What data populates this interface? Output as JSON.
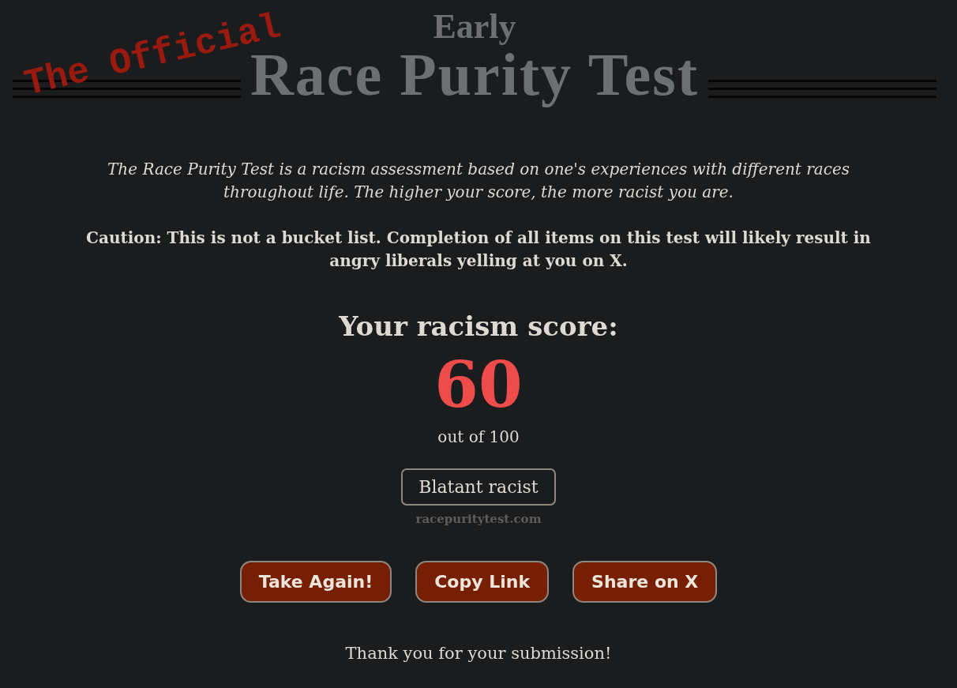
{
  "header": {
    "stamp": "The Official",
    "prefix": "Early",
    "title": "Race Purity Test"
  },
  "intro": "The Race Purity Test is a racism assessment based on one's experiences with different races throughout life. The higher your score, the more racist you are.",
  "caution": "Caution: This is not a bucket list. Completion of all items on this test will likely result in angry liberals yelling at you on X.",
  "score": {
    "heading": "Your racism score:",
    "value": "60",
    "out_of": "out of 100"
  },
  "verdict": "Blatant racist",
  "site": "racepuritytest.com",
  "buttons": [
    "Take Again!",
    "Copy Link",
    "Share on X"
  ],
  "thanks": "Thank you for your submission!"
}
